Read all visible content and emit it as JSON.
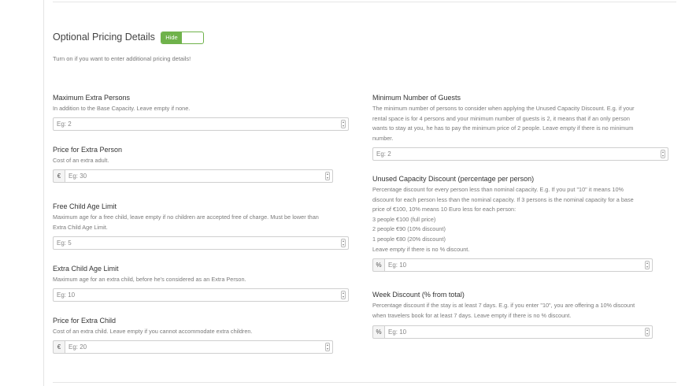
{
  "section": {
    "title": "Optional Pricing Details",
    "toggle_label": "Hide",
    "intro": "Turn on if you want to enter additional pricing details!"
  },
  "fields": {
    "max_extra_persons": {
      "label": "Maximum Extra Persons",
      "help": [
        "In addition to the Base Capacity. Leave empty if none."
      ],
      "placeholder": "Eg: 2"
    },
    "price_extra_person": {
      "label": "Price for Extra Person",
      "help": [
        "Cost of an extra adult."
      ],
      "addon": "€",
      "placeholder": "Eg: 30"
    },
    "free_child_age": {
      "label": "Free Child Age Limit",
      "help": [
        "Maximum age for a free child, leave empty if no children are accepted free of charge. Must be lower than",
        "Extra Child Age Limit."
      ],
      "placeholder": "Eg: 5"
    },
    "extra_child_age": {
      "label": "Extra Child Age Limit",
      "help": [
        "Maximum age for an extra child, before he's considered as an Extra Person."
      ],
      "placeholder": "Eg: 10"
    },
    "price_extra_child": {
      "label": "Price for Extra Child",
      "help": [
        "Cost of an extra child. Leave empty if you cannot accommodate extra children."
      ],
      "addon": "€",
      "placeholder": "Eg: 20"
    },
    "min_guests": {
      "label": "Minimum Number of Guests",
      "help": [
        "The minimum number of persons to consider when applying the Unused Capacity Discount. E.g. if your",
        "rental space is for 4 persons and your minimum number of guests is 2, it means that if an only person",
        "wants to stay at you, he has to pay the minimum price of 2 people. Leave empty if there is no minimum",
        "number."
      ],
      "placeholder": "Eg: 2"
    },
    "unused_capacity_discount": {
      "label": "Unused Capacity Discount (percentage per person)",
      "help": [
        "Percentage discount for every person less than nominal capacity. E.g. If you put \"10\" it means 10%",
        "discount for each person less than the nominal capacity. If 3 persons is the nominal capacity for a base",
        "price of €100, 10% means 10 Euro less for each person:",
        "3 people €100 (full price)",
        "2 people €90 (10% discount)",
        "1 people €80 (20% discount)",
        "Leave empty if there is no % discount."
      ],
      "addon": "%",
      "placeholder": "Eg: 10"
    },
    "week_discount": {
      "label": "Week Discount (% from total)",
      "help": [
        "Percentage discount if the stay is at least 7 days. E.g. if you enter \"10\", you are offering a 10% discount",
        "when travelers book for at least 7 days. Leave empty if there is no % discount."
      ],
      "addon": "%",
      "placeholder": "Eg: 10"
    }
  }
}
